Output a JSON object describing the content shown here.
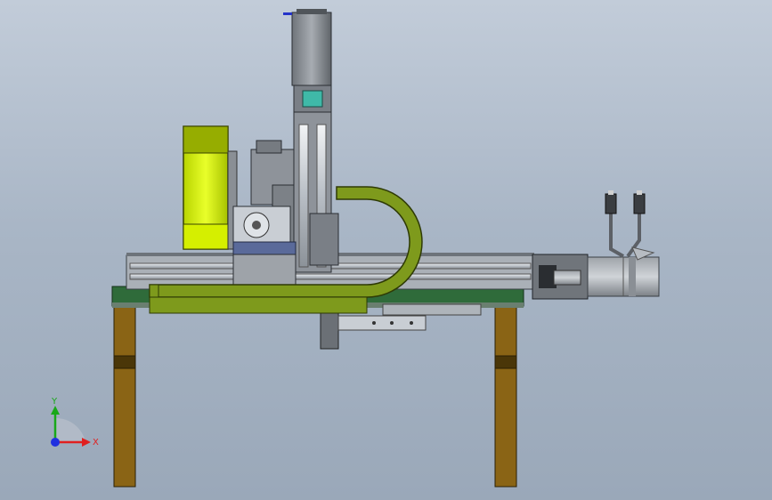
{
  "viewport": {
    "background_top": "#c2ccd9",
    "background_bottom": "#9aa8b9"
  },
  "triad": {
    "x_label": "X",
    "y_label": "Y",
    "x_color": "#e02020",
    "y_color": "#18a818",
    "z_color": "#2030e0"
  },
  "colors": {
    "frame_green": "#2f6b3a",
    "leg_brown": "#8a6415",
    "cable_chain": "#7e9a1c",
    "hood_yellow": "#d8f000",
    "steel_gray": "#8e939a",
    "rail_silver": "#c9ced4",
    "slider_blue": "#5a6a9a",
    "sensor_teal": "#3fb9a8"
  },
  "icons": {
    "axis_triad": "axis-triad-icon",
    "servo_motor_vertical": "servo-motor-icon",
    "servo_motor_horizontal": "servo-motor-icon",
    "connector_a": "cable-connector-icon",
    "connector_b": "cable-connector-icon"
  }
}
